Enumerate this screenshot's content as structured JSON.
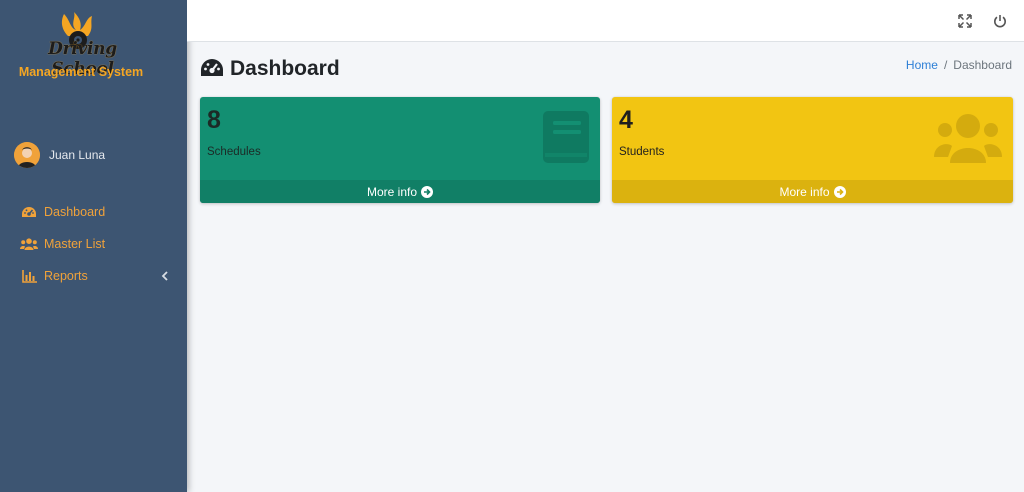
{
  "brand": {
    "line1": "Driving School",
    "line2": "Management System"
  },
  "user": {
    "name": "Juan Luna"
  },
  "nav": {
    "items": [
      {
        "label": "Dashboard",
        "icon": "tachometer-icon"
      },
      {
        "label": "Master List",
        "icon": "users-icon"
      },
      {
        "label": "Reports",
        "icon": "bar-chart-icon"
      }
    ]
  },
  "topbar": {
    "icons": [
      "expand-icon",
      "power-icon"
    ]
  },
  "page": {
    "title": "Dashboard"
  },
  "breadcrumb": {
    "home": "Home",
    "separator": "/",
    "current": "Dashboard"
  },
  "boxes": [
    {
      "count": "8",
      "label": "Schedules",
      "footer": "More info",
      "icon": "book-icon",
      "color": "#138f72"
    },
    {
      "count": "4",
      "label": "Students",
      "footer": "More info",
      "icon": "users-icon",
      "color": "#f2c512"
    }
  ],
  "colors": {
    "sidebar": "#3d5572",
    "accent": "#f0a23a",
    "link": "#2d7fd6"
  }
}
